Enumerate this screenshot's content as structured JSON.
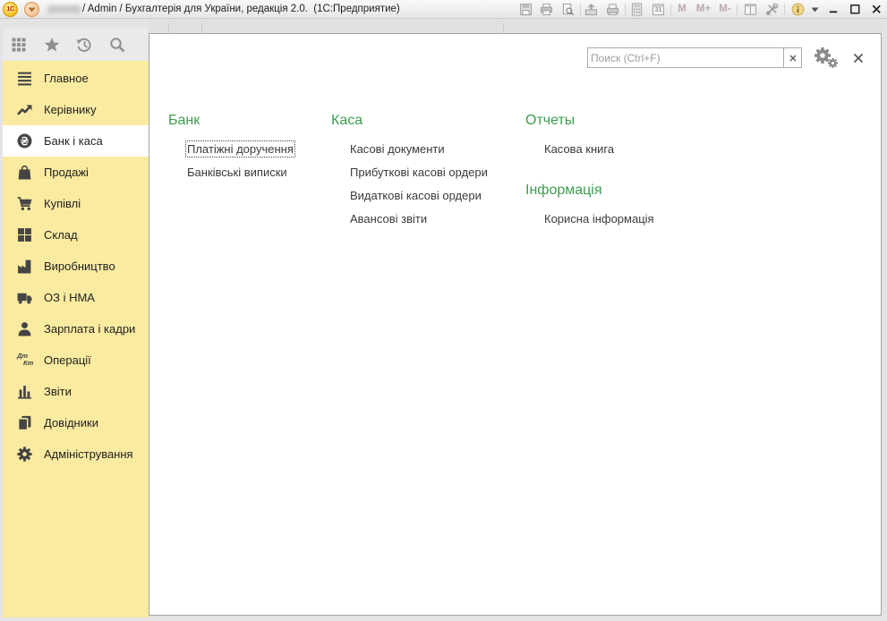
{
  "titlebar": {
    "logo_text": "1С",
    "title": "/ Admin / Бухгалтерія для України, редакція 2.0.  (1С:Предприятие)",
    "calendar_day": "31",
    "memory_buttons": {
      "m": "M",
      "m_plus": "M+",
      "m_minus": "M-"
    },
    "icons": [
      "main-menu-dropdown-icon",
      "save-icon",
      "print-icon",
      "print-preview-icon",
      "document-arrow-icon",
      "printer-paper-icon",
      "calculator-icon",
      "calendar-icon",
      "window-icon",
      "tools-icon",
      "info-icon",
      "minimize-icon",
      "maximize-icon",
      "close-icon"
    ]
  },
  "sidebar": {
    "toolbar_icons": [
      "apps-grid-icon",
      "favorites-star-icon",
      "history-icon",
      "search-icon"
    ],
    "items": [
      {
        "label": "Главное",
        "icon": "list-icon",
        "selected": false
      },
      {
        "label": "Керівнику",
        "icon": "trend-icon",
        "selected": false
      },
      {
        "label": "Банк і каса",
        "icon": "hryvnia-coin-icon",
        "selected": true
      },
      {
        "label": "Продажі",
        "icon": "shopping-bag-icon",
        "selected": false
      },
      {
        "label": "Купівлі",
        "icon": "cart-icon",
        "selected": false
      },
      {
        "label": "Склад",
        "icon": "warehouse-blocks-icon",
        "selected": false
      },
      {
        "label": "Виробництво",
        "icon": "factory-icon",
        "selected": false
      },
      {
        "label": "ОЗ і НМА",
        "icon": "truck-icon",
        "selected": false
      },
      {
        "label": "Зарплата і кадри",
        "icon": "person-icon",
        "selected": false
      },
      {
        "label": "Операції",
        "icon": "debit-credit-icon",
        "icon_text": [
          "Дт",
          "Кт"
        ],
        "selected": false
      },
      {
        "label": "Звіти",
        "icon": "bar-chart-icon",
        "selected": false
      },
      {
        "label": "Довідники",
        "icon": "books-icon",
        "selected": false
      },
      {
        "label": "Адміністрування",
        "icon": "gear-icon",
        "selected": false
      }
    ]
  },
  "content": {
    "search": {
      "placeholder": "Поиск (Ctrl+F)",
      "value": ""
    },
    "header_icons": [
      "clear-search-icon",
      "settings-gears-icon",
      "close-panel-icon"
    ],
    "sections": [
      {
        "heading": "Банк",
        "links": [
          {
            "label": "Платіжні доручення",
            "focused": true
          },
          {
            "label": "Банківські виписки",
            "focused": false
          }
        ]
      },
      {
        "heading": "Каса",
        "links": [
          {
            "label": "Касові документи",
            "focused": false
          },
          {
            "label": "Прибуткові касові ордери",
            "focused": false
          },
          {
            "label": "Видаткові касові ордери",
            "focused": false
          },
          {
            "label": "Авансові звіти",
            "focused": false
          }
        ]
      },
      {
        "heading": "Отчеты",
        "links": [
          {
            "label": "Касова книга",
            "focused": false
          }
        ]
      },
      {
        "heading": "Інформація",
        "links": [
          {
            "label": "Корисна інформація",
            "focused": false
          }
        ]
      }
    ]
  },
  "colors": {
    "sidebar_bg": "#FAEBA0",
    "selected_item_bg": "#FFFFFF",
    "section_heading": "#3D9D4E",
    "link_text": "#3A3A3A",
    "window_bg": "#E4E4E4"
  }
}
